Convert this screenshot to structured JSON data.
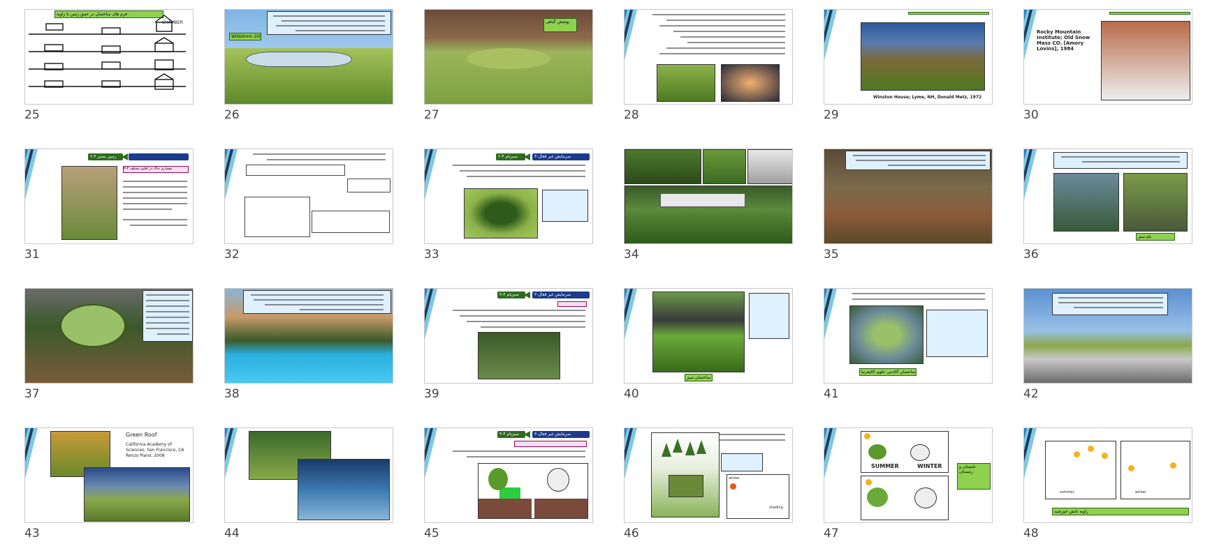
{
  "slides": [
    {
      "number": "25",
      "text": "فرم های ساختمان در عمق زمین با زاویه",
      "labels": [
        "CHAMBER"
      ]
    },
    {
      "number": "26",
      "text": "ساختمان در دل تپه",
      "labels": [
        "Wildstrom 2003"
      ]
    },
    {
      "number": "27",
      "text": "پوشش گیاهی"
    },
    {
      "number": "28",
      "text": "ساختمان های زیرزمینی"
    },
    {
      "number": "29",
      "text": "Winston House; Lyme, NH, Donald Metz, 1972"
    },
    {
      "number": "30",
      "text": "Rocky Mountain Institute; Old Snow Mass CO. [Amory Lovins], 1984"
    },
    {
      "number": "31",
      "text": "۲-۴ زمین بستر",
      "labels": [
        "۳-۳ معماری خاک در اقلیم مختلف"
      ]
    },
    {
      "number": "32",
      "text": "جریان حرارتی"
    },
    {
      "number": "33",
      "text": "۳-سرمایش غیر فعال",
      "labels": [
        "۲-۴ سبزبام"
      ]
    },
    {
      "number": "34",
      "text": ""
    },
    {
      "number": "35",
      "text": "فضای سبز"
    },
    {
      "number": "36",
      "text": "بام سبز"
    },
    {
      "number": "37",
      "text": "بام سبز"
    },
    {
      "number": "38",
      "text": "استخر"
    },
    {
      "number": "39",
      "text": "۳-سرمایش غیر فعال",
      "labels": [
        "۳-۴ سبزبام"
      ]
    },
    {
      "number": "40",
      "text": "ساختمان سبز"
    },
    {
      "number": "41",
      "text": "ساختمان آکادمی علوم کالیفرنیا"
    },
    {
      "number": "42",
      "text": "California Academy of Sciences"
    },
    {
      "number": "43",
      "text": "Green Roof",
      "labels": [
        "California Academy of Sciences, San Francisco, CA",
        "Renzo Piano, 2008"
      ]
    },
    {
      "number": "44",
      "text": ""
    },
    {
      "number": "45",
      "text": "۳-سرمایش غیر فعال",
      "labels": [
        "۴-۴ سبزبام"
      ]
    },
    {
      "number": "46",
      "text": "گیاهان",
      "labels": [
        "winter",
        "shading"
      ]
    },
    {
      "number": "47",
      "text": "تابستان و زمستان",
      "labels": [
        "SUMMER",
        "WINTER"
      ]
    },
    {
      "number": "48",
      "text": "زاویه تابش خورشید",
      "labels": [
        "summer",
        "winter"
      ]
    }
  ]
}
